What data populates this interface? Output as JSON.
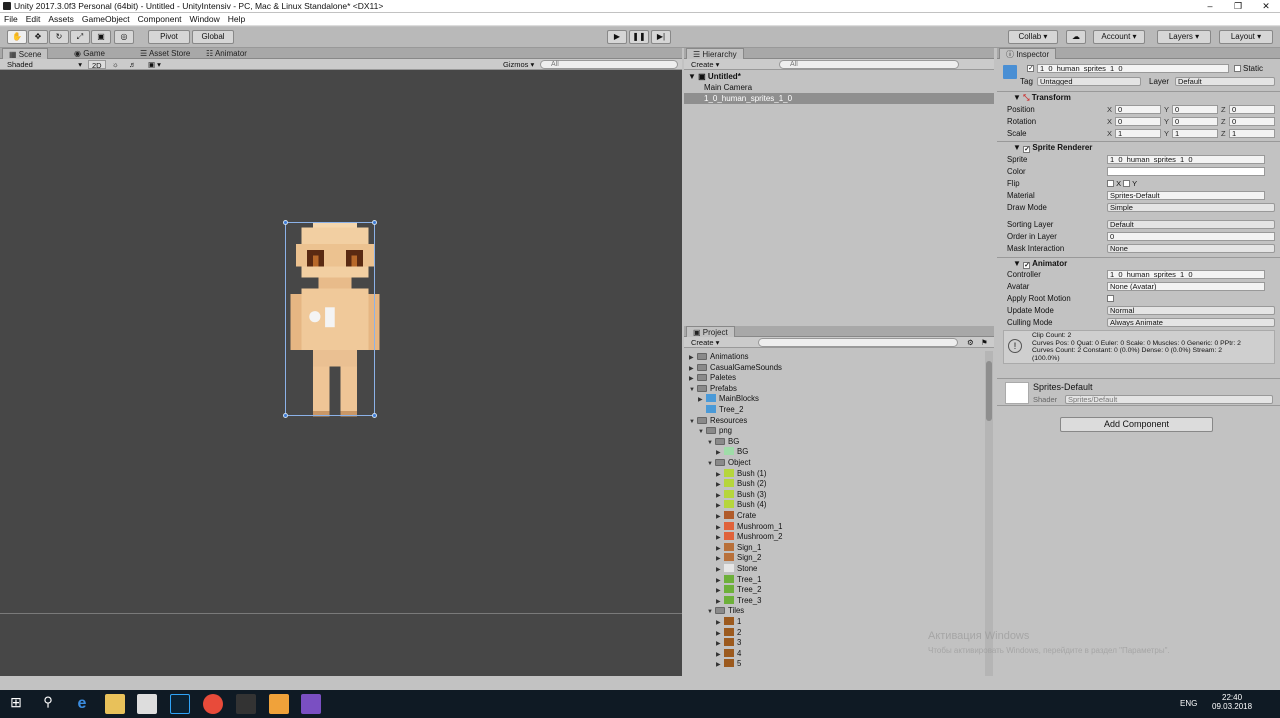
{
  "window": {
    "title": "Unity 2017.3.0f3 Personal (64bit) - Untitled - UnityIntensiv - PC, Mac & Linux Standalone* <DX11>"
  },
  "menu": [
    "File",
    "Edit",
    "Assets",
    "GameObject",
    "Component",
    "Window",
    "Help"
  ],
  "toolbar": {
    "pivot": "Pivot",
    "global": "Global",
    "collab": "Collab ▾",
    "account": "Account",
    "layers": "Layers",
    "layout": "Layout"
  },
  "tabs": {
    "scene": "Scene",
    "game": "Game",
    "asset_store": "Asset Store",
    "animator": "Animator",
    "hierarchy": "Hierarchy",
    "project": "Project",
    "inspector": "Inspector"
  },
  "scene_bar": {
    "shaded": "Shaded",
    "mode2d": "2D",
    "gizmos": "Gizmos ▾",
    "search": "All"
  },
  "hierarchy": {
    "create": "Create ▾",
    "search": "All",
    "scene_name": "Untitled*",
    "items": [
      "Main Camera",
      "1_0_human_sprites_1_0"
    ]
  },
  "project": {
    "create": "Create ▾",
    "tree": [
      {
        "label": "Animations",
        "depth": 0,
        "tri": "▶",
        "icon": "folder"
      },
      {
        "label": "CasualGameSounds",
        "depth": 0,
        "tri": "▶",
        "icon": "folder"
      },
      {
        "label": "Paletes",
        "depth": 0,
        "tri": "▶",
        "icon": "folder"
      },
      {
        "label": "Prefabs",
        "depth": 0,
        "tri": "▼",
        "icon": "folder"
      },
      {
        "label": "MainBlocks",
        "depth": 1,
        "tri": "▶",
        "icon": "prefab"
      },
      {
        "label": "Tree_2",
        "depth": 1,
        "tri": "",
        "icon": "prefab"
      },
      {
        "label": "Resources",
        "depth": 0,
        "tri": "▼",
        "icon": "folder"
      },
      {
        "label": "png",
        "depth": 1,
        "tri": "▼",
        "icon": "folder"
      },
      {
        "label": "BG",
        "depth": 2,
        "tri": "▼",
        "icon": "folder"
      },
      {
        "label": "BG",
        "depth": 3,
        "tri": "▶",
        "icon": "bg"
      },
      {
        "label": "Object",
        "depth": 2,
        "tri": "▼",
        "icon": "folder"
      },
      {
        "label": "Bush (1)",
        "depth": 3,
        "tri": "▶",
        "icon": "bush"
      },
      {
        "label": "Bush (2)",
        "depth": 3,
        "tri": "▶",
        "icon": "bush"
      },
      {
        "label": "Bush (3)",
        "depth": 3,
        "tri": "▶",
        "icon": "bush"
      },
      {
        "label": "Bush (4)",
        "depth": 3,
        "tri": "▶",
        "icon": "bush"
      },
      {
        "label": "Crate",
        "depth": 3,
        "tri": "▶",
        "icon": "crate"
      },
      {
        "label": "Mushroom_1",
        "depth": 3,
        "tri": "▶",
        "icon": "mush"
      },
      {
        "label": "Mushroom_2",
        "depth": 3,
        "tri": "▶",
        "icon": "mush"
      },
      {
        "label": "Sign_1",
        "depth": 3,
        "tri": "▶",
        "icon": "sign"
      },
      {
        "label": "Sign_2",
        "depth": 3,
        "tri": "▶",
        "icon": "sign"
      },
      {
        "label": "Stone",
        "depth": 3,
        "tri": "▶",
        "icon": "stone"
      },
      {
        "label": "Tree_1",
        "depth": 3,
        "tri": "▶",
        "icon": "tree"
      },
      {
        "label": "Tree_2",
        "depth": 3,
        "tri": "▶",
        "icon": "tree"
      },
      {
        "label": "Tree_3",
        "depth": 3,
        "tri": "▶",
        "icon": "tree"
      },
      {
        "label": "Tiles",
        "depth": 2,
        "tri": "▼",
        "icon": "folder"
      },
      {
        "label": "1",
        "depth": 3,
        "tri": "▶",
        "icon": "tile"
      },
      {
        "label": "2",
        "depth": 3,
        "tri": "▶",
        "icon": "tile"
      },
      {
        "label": "3",
        "depth": 3,
        "tri": "▶",
        "icon": "tile"
      },
      {
        "label": "4",
        "depth": 3,
        "tri": "▶",
        "icon": "tile"
      },
      {
        "label": "5",
        "depth": 3,
        "tri": "▶",
        "icon": "tile"
      }
    ]
  },
  "inspector": {
    "object_name": "1_0_human_sprites_1_0",
    "static": "Static",
    "tag_label": "Tag",
    "tag_value": "Untagged",
    "layer_label": "Layer",
    "layer_value": "Default",
    "transform": {
      "title": "Transform",
      "position": "Position",
      "rotation": "Rotation",
      "scale": "Scale",
      "pos": [
        "0",
        "0",
        "0"
      ],
      "rot": [
        "0",
        "0",
        "0"
      ],
      "scl": [
        "1",
        "1",
        "1"
      ]
    },
    "sprite_renderer": {
      "title": "Sprite Renderer",
      "sprite_label": "Sprite",
      "sprite": "1_0_human_sprites_1_0",
      "color_label": "Color",
      "flip_label": "Flip",
      "flip_x": "X",
      "flip_y": "Y",
      "material_label": "Material",
      "material": "Sprites-Default",
      "draw_mode_label": "Draw Mode",
      "draw_mode": "Simple",
      "sorting_label": "Sorting Layer",
      "sorting": "Default",
      "order_label": "Order in Layer",
      "order": "0",
      "mask_label": "Mask Interaction",
      "mask": "None"
    },
    "animator": {
      "title": "Animator",
      "controller_label": "Controller",
      "controller": "1_0_human_sprites_1_0",
      "avatar_label": "Avatar",
      "avatar": "None (Avatar)",
      "root_label": "Apply Root Motion",
      "update_label": "Update Mode",
      "update": "Normal",
      "culling_label": "Culling Mode",
      "culling": "Always Animate",
      "info": [
        "Clip Count: 2",
        "Curves Pos: 0 Quat: 0 Euler: 0 Scale: 0 Muscles: 0 Generic: 0 PPtr: 2",
        "Curves Count: 2 Constant: 0 (0.0%) Dense: 0 (0.0%) Stream: 2",
        "(100.0%)"
      ]
    },
    "material": {
      "name": "Sprites-Default",
      "shader_label": "Shader",
      "shader": "Sprites/Default"
    },
    "add_component": "Add Component"
  },
  "watermark": {
    "line1": "Активация Windows",
    "line2": "Чтобы активировать Windows, перейдите в раздел \"Параметры\"."
  },
  "taskbar": {
    "lang": "ENG",
    "time": "22:40",
    "date": "09.03.2018"
  }
}
